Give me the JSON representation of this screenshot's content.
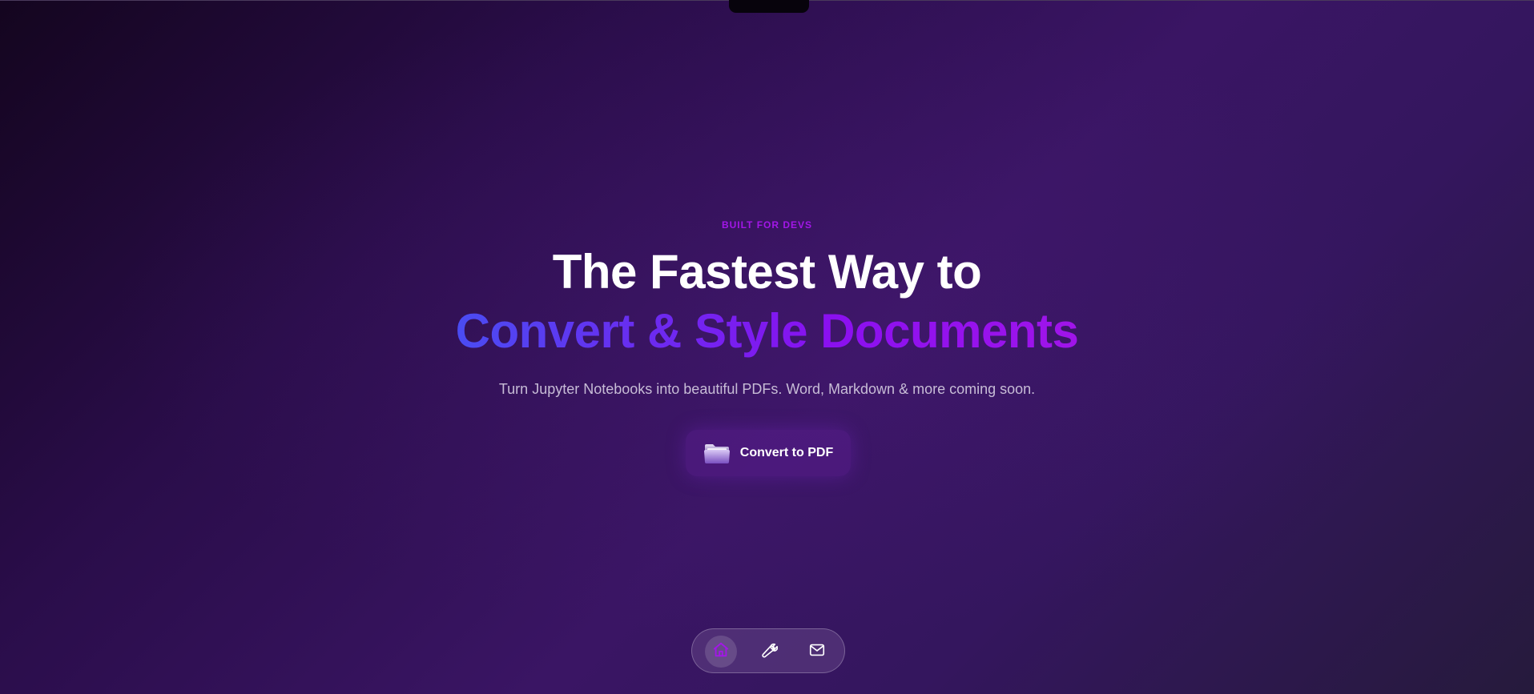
{
  "hero": {
    "eyebrow": "BUILT FOR DEVS",
    "headline_line1": "The Fastest Way to",
    "headline_line2": "Convert & Style Documents",
    "subtitle": "Turn Jupyter Notebooks into beautiful PDFs. Word, Markdown & more coming soon."
  },
  "cta": {
    "label": "Convert to PDF",
    "icon": "folder-icon"
  },
  "dock": {
    "items": [
      {
        "icon": "home-icon",
        "active": true
      },
      {
        "icon": "wrench-icon",
        "active": false
      },
      {
        "icon": "mail-icon",
        "active": false
      }
    ]
  },
  "colors": {
    "accent": "#a316e8",
    "gradient_start": "#4a4cf2",
    "gradient_end": "#a014ea",
    "background_dark": "#14051f",
    "background_mid": "#3a1564"
  }
}
